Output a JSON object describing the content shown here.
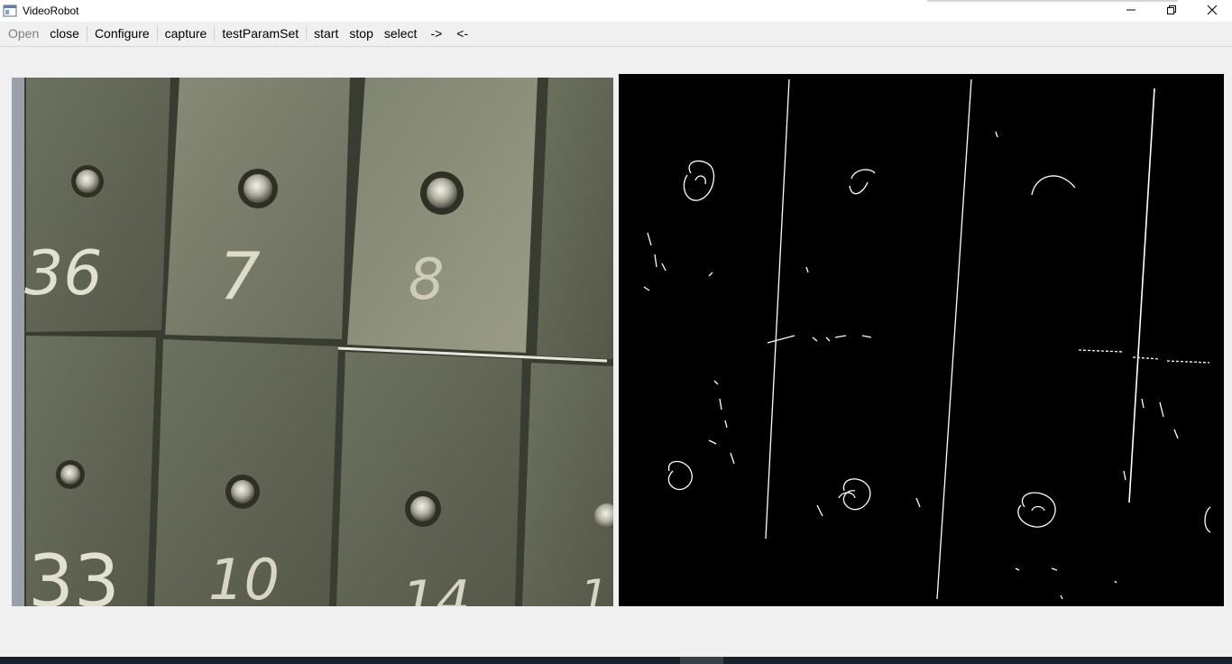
{
  "window": {
    "title": "VideoRobot",
    "icons": {
      "app": "app-window-icon",
      "minimize": "minimize-icon",
      "maximize": "restore-icon",
      "close": "close-icon"
    }
  },
  "toolbar": {
    "open": "Open",
    "close": "close",
    "configure": "Configure",
    "capture": "capture",
    "testParamSet": "testParamSet",
    "start": "start",
    "stop": "stop",
    "select": "select",
    "next": "->",
    "prev": "<-"
  },
  "views": {
    "camera_image": {
      "digits": [
        "36",
        "7",
        "8",
        "33",
        "10",
        "14",
        "1"
      ]
    },
    "edge_image": {}
  },
  "colors": {
    "window_bg": "#f0f0f0",
    "edge_bg": "#000000",
    "edge_stroke": "#ffffff",
    "taskbar": "#1b2128"
  }
}
